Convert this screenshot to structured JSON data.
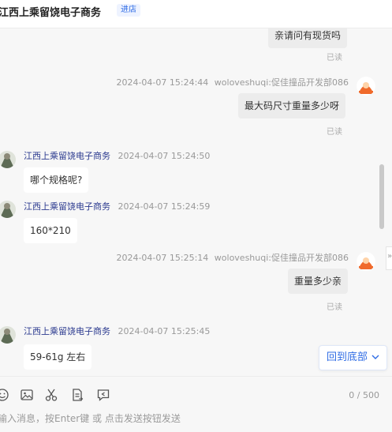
{
  "header": {
    "shop_name": "江西上乘留饶电子商务",
    "enter_label": "进店"
  },
  "messages": {
    "m0": {
      "text": "亲请问有现货吗",
      "read": "已读"
    },
    "m1": {
      "time": "2024-04-07 15:24:44",
      "sender": "woloveshuqi:促佳撞品开发部086",
      "text": "最大码尺寸重量多少呀",
      "read": "已读"
    },
    "m2": {
      "sender": "江西上乘留饶电子商务",
      "time": "2024-04-07 15:24:50",
      "text": "哪个规格呢?"
    },
    "m3": {
      "sender": "江西上乘留饶电子商务",
      "time": "2024-04-07 15:24:59",
      "text": "160*210"
    },
    "m4": {
      "time": "2024-04-07 15:25:14",
      "sender": "woloveshuqi:促佳撞品开发部086",
      "text": "重量多少亲",
      "read": "已读"
    },
    "m5": {
      "sender": "江西上乘留饶电子商务",
      "time": "2024-04-07 15:25:45",
      "text": "59-61g 左右"
    }
  },
  "back_to_bottom": {
    "label": "回到底部",
    "icon": "chevron-down-icon"
  },
  "side_tab": {
    "glyph": "»"
  },
  "toolbar": {
    "icons": [
      "emoji-icon",
      "image-icon",
      "scissors-icon",
      "document-icon",
      "quick-reply-icon"
    ],
    "counter": "0 / 500",
    "placeholder": "输入消息，按Enter键 或 点击发送按钮发送"
  },
  "colors": {
    "accent": "#2f6ce5",
    "sender_name": "#2b3a8f",
    "bubble_self": "#ececec",
    "bubble_other": "#ffffff",
    "background": "#f7f7f7"
  }
}
